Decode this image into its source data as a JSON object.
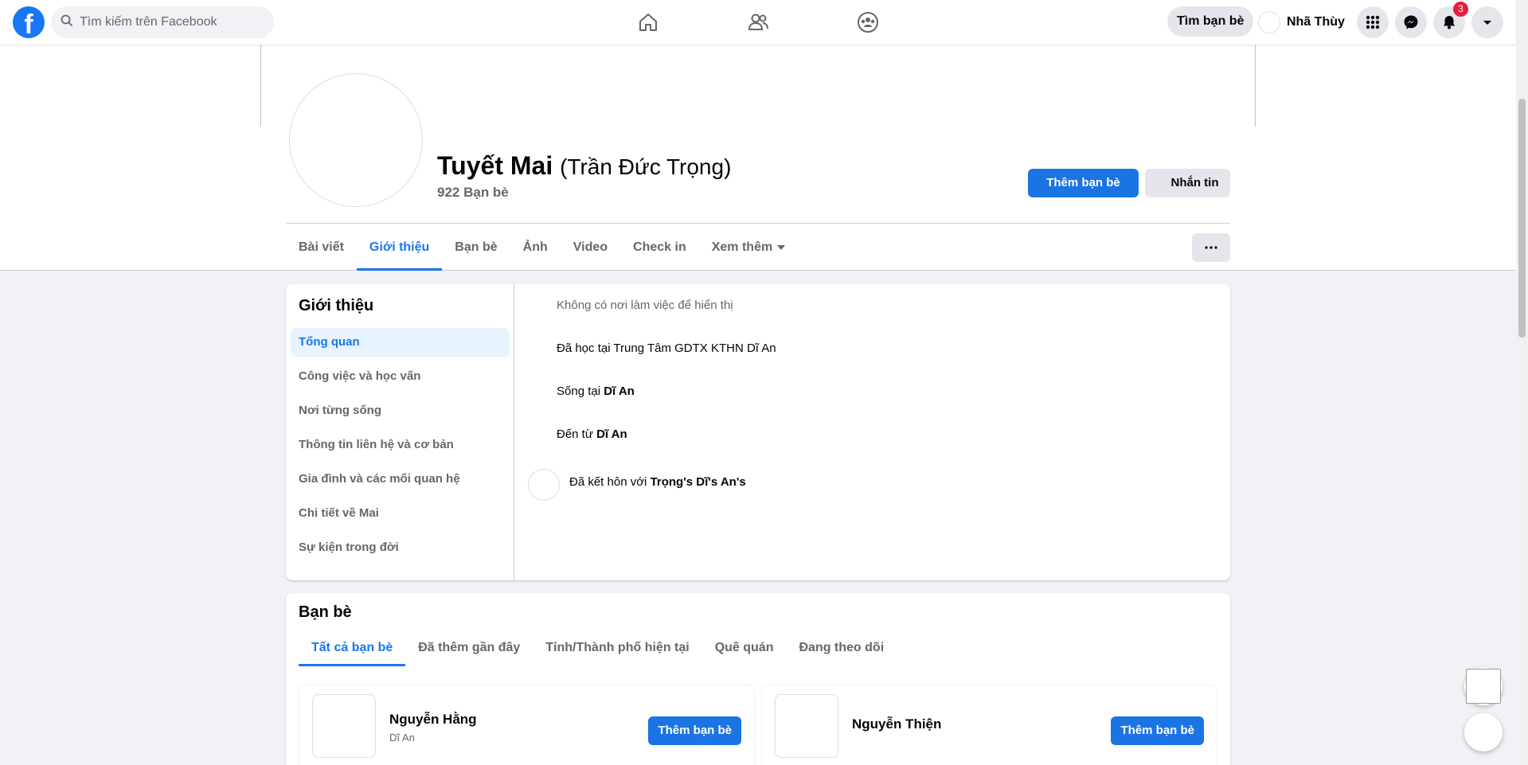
{
  "topbar": {
    "logo_letter": "f",
    "search_placeholder": "Tìm kiếm trên Facebook",
    "find_friends_label": "Tìm bạn bè",
    "user_name": "Nhã Thùy",
    "notification_count": "3"
  },
  "profile": {
    "name": "Tuyết Mai",
    "alt_name": "(Trần Đức Trọng)",
    "friend_count": "922 Bạn bè",
    "add_friend_label": "Thêm bạn bè",
    "message_label": "Nhắn tin",
    "more_label": "···"
  },
  "tabs": [
    {
      "label": "Bài viết"
    },
    {
      "label": "Giới thiệu"
    },
    {
      "label": "Bạn bè"
    },
    {
      "label": "Ảnh"
    },
    {
      "label": "Video"
    },
    {
      "label": "Check in"
    },
    {
      "label": "Xem thêm"
    }
  ],
  "intro": {
    "title": "Giới thiệu",
    "nav": [
      {
        "label": "Tổng quan"
      },
      {
        "label": "Công việc và học vấn"
      },
      {
        "label": "Nơi từng sống"
      },
      {
        "label": "Thông tin liên hệ và cơ bản"
      },
      {
        "label": "Gia đình và các mối quan hệ"
      },
      {
        "label": "Chi tiết về Mai"
      },
      {
        "label": "Sự kiện trong đời"
      }
    ],
    "no_work": "Không có nơi làm việc để hiển thị",
    "studied": "Đã học tại Trung Tâm GDTX KTHN Dĩ An",
    "lives_prefix": "Sống tại ",
    "lives_place": "Dĩ An",
    "from_prefix": "Đến từ ",
    "from_place": "Dĩ An",
    "married_prefix": "Đã kết hôn với ",
    "married_to": "Trọng's Dĩ's An's"
  },
  "friends": {
    "title": "Bạn bè",
    "tabs": [
      {
        "label": "Tất cả bạn bè"
      },
      {
        "label": "Đã thêm gần đây"
      },
      {
        "label": "Tỉnh/Thành phố hiện tại"
      },
      {
        "label": "Quê quán"
      },
      {
        "label": "Đang theo dõi"
      }
    ],
    "items": [
      {
        "name": "Nguyễn Hằng",
        "location": "Dĩ An",
        "button": "Thêm bạn bè"
      },
      {
        "name": "Nguyễn Thiện",
        "location": "",
        "button": "Thêm bạn bè"
      }
    ]
  },
  "colors": {
    "brand": "#1877f2",
    "badge": "#e41e3f",
    "background": "#f0f2f5"
  },
  "icons": [
    "search-icon",
    "home-icon",
    "friends-icon",
    "groups-icon",
    "menu-grid-icon",
    "messenger-icon",
    "bell-icon",
    "caret-down-icon"
  ]
}
